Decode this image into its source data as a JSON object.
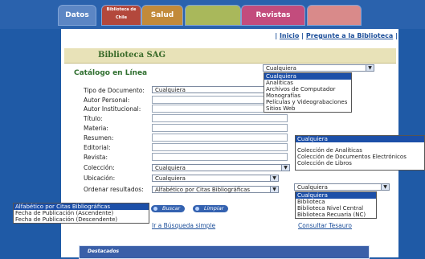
{
  "header": {
    "tabs": [
      "Datos",
      "Biblioteca de Chile",
      "Salud",
      "",
      "Revistas",
      ""
    ],
    "links": [
      "Inicio",
      "Pregunte a la Biblioteca"
    ]
  },
  "title": "Biblioteca SAG",
  "catalogo": "Catálogo en Línea",
  "form": {
    "labels": [
      "Tipo de Documento:",
      "Autor Personal:",
      "Autor Institucional:",
      "Título:",
      "Materia:",
      "Resumen:",
      "Editorial:",
      "Revista:",
      "Colección:",
      "Ubicación:",
      "Ordenar resultados:"
    ],
    "tipo_value": "Cualquiera",
    "coleccion_value": "Cualquiera",
    "ubicacion_value": "Cualquiera",
    "ordenar_value": "Alfabético por Citas Bibliográficas"
  },
  "dropdown_tipo": {
    "value": "Cualquiera",
    "options": [
      "Cualquiera",
      "Analíticas",
      "Archivos de Computador",
      "Monografías",
      "Películas y Videograbaciones",
      "Sitios Web"
    ]
  },
  "dropdown_coleccion": {
    "options": [
      "Cualquiera",
      "Colección de Analíticas",
      "Colección de Documentos Electrónicos",
      "Colección de Libros"
    ]
  },
  "dropdown_ubicacion": {
    "value": "Cualquiera",
    "options": [
      "Cualquiera",
      "Biblioteca",
      "Biblioteca Nivel Central",
      "Biblioteca Recuaria (NC)"
    ]
  },
  "dropdown_ordenar": {
    "options": [
      "Alfabético por Citas Bibliográficas",
      "Fecha de Publicación (Ascendente)",
      "Fecha de Publicación (Descendente)"
    ]
  },
  "buttons": {
    "buscar": "Buscar",
    "limpiar": "Limpiar"
  },
  "links_bottom": {
    "busqueda_simple": "Ir a Búsqueda simple",
    "tesauro": "Consultar Tesauro"
  },
  "destacados": "Destacados",
  "colors": {
    "background": "#1f5aa6",
    "accent": "#1c4fa8",
    "title_green": "#3a6b2a"
  }
}
